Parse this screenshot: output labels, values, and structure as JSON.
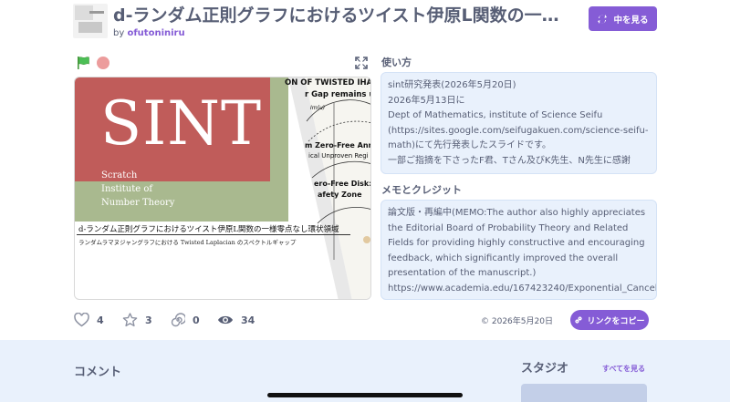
{
  "header": {
    "title": "d-ランダム正則グラフにおけるツイスト伊原L関数の一様零点なし環状領域",
    "by_prefix": "by",
    "author": "ofutoniniru",
    "see_inside_label": "中を見る"
  },
  "stage": {
    "big_word": "SINT",
    "subtitle_lines": [
      "Scratch",
      "Institute of",
      "Number Theory"
    ],
    "title_line": "d-ランダム正則グラフにおけるツイスト伊原L関数の一様零点なし環状領域",
    "subtitle_line": "ランダムラマヌジャングラフにおける Twisted Laplacian のスペクトルギャップ",
    "paper_lines": [
      "ON OF TWISTED IHARA",
      "r Gap remains uniform",
      "Im(u)",
      "m Zero-Free Annul",
      "ical Unproven Regi",
      "ero-Free Disk:",
      "afety Zone"
    ]
  },
  "instructions": {
    "heading": "使い方",
    "lines": [
      "sint研究発表(2026年5月20日)",
      "2026年5月13日に",
      "Dept of Mathematics, institute of Science Seifu",
      "(https://sites.google.com/seifugakuen.com/science-seifu-math)にて先行発表したスライドです。",
      "一部ご指摘を下さったF君、Tさん及びK先生、N先生に感謝"
    ]
  },
  "notes": {
    "heading": "メモとクレジット",
    "lines": [
      "論文版・再編中(MEMO:The author also highly appreciates the Editorial Board of Probability Theory and Related Fields for providing highly constructive and encouraging feedback, which significantly improved the overall presentation of the manuscript.)",
      "https://www.academia.edu/167423240/Exponential_Cancel"
    ]
  },
  "stats": {
    "loves": "4",
    "favorites": "3",
    "remixes": "0",
    "views": "34",
    "date": "© 2026年5月20日",
    "copy_link_label": "リンクをコピー"
  },
  "bottom": {
    "comments_heading": "コメント",
    "studios_heading": "スタジオ",
    "see_all_label": "すべてを見る"
  },
  "colors": {
    "accent": "#855cd6",
    "panel_bg": "#e9f1fc",
    "text": "#575e75",
    "sint_red": "#c05c5a",
    "sint_green": "#a9b98f"
  },
  "icons": {
    "flag": "green-flag-icon",
    "stop": "stop-icon",
    "fullscreen": "fullscreen-icon",
    "see_inside": "remix-arrows-icon",
    "love": "heart-icon",
    "favorite": "star-icon",
    "remix": "spiral-icon",
    "views": "eye-icon",
    "link": "link-icon"
  }
}
